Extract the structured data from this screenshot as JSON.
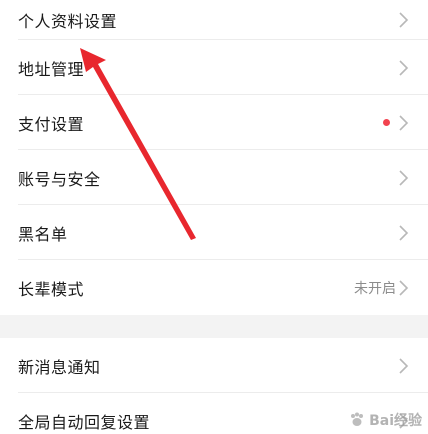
{
  "settings": {
    "group1": [
      {
        "label": "个人资料设置",
        "status": "",
        "dot": false
      },
      {
        "label": "地址管理",
        "status": "",
        "dot": false
      },
      {
        "label": "支付设置",
        "status": "",
        "dot": true
      },
      {
        "label": "账号与安全",
        "status": "",
        "dot": false
      },
      {
        "label": "黑名单",
        "status": "",
        "dot": false
      },
      {
        "label": "长辈模式",
        "status": "未开启",
        "dot": false
      }
    ],
    "group2": [
      {
        "label": "新消息通知",
        "status": "",
        "dot": false
      },
      {
        "label": "全局自动回复设置",
        "status": "",
        "dot": false
      }
    ]
  },
  "colors": {
    "dot": "#f2434f",
    "arrow": "#e8272e",
    "chevron": "#b8b8b8"
  },
  "watermark": {
    "text": "Bai经验",
    "icon": "paw-logo"
  }
}
